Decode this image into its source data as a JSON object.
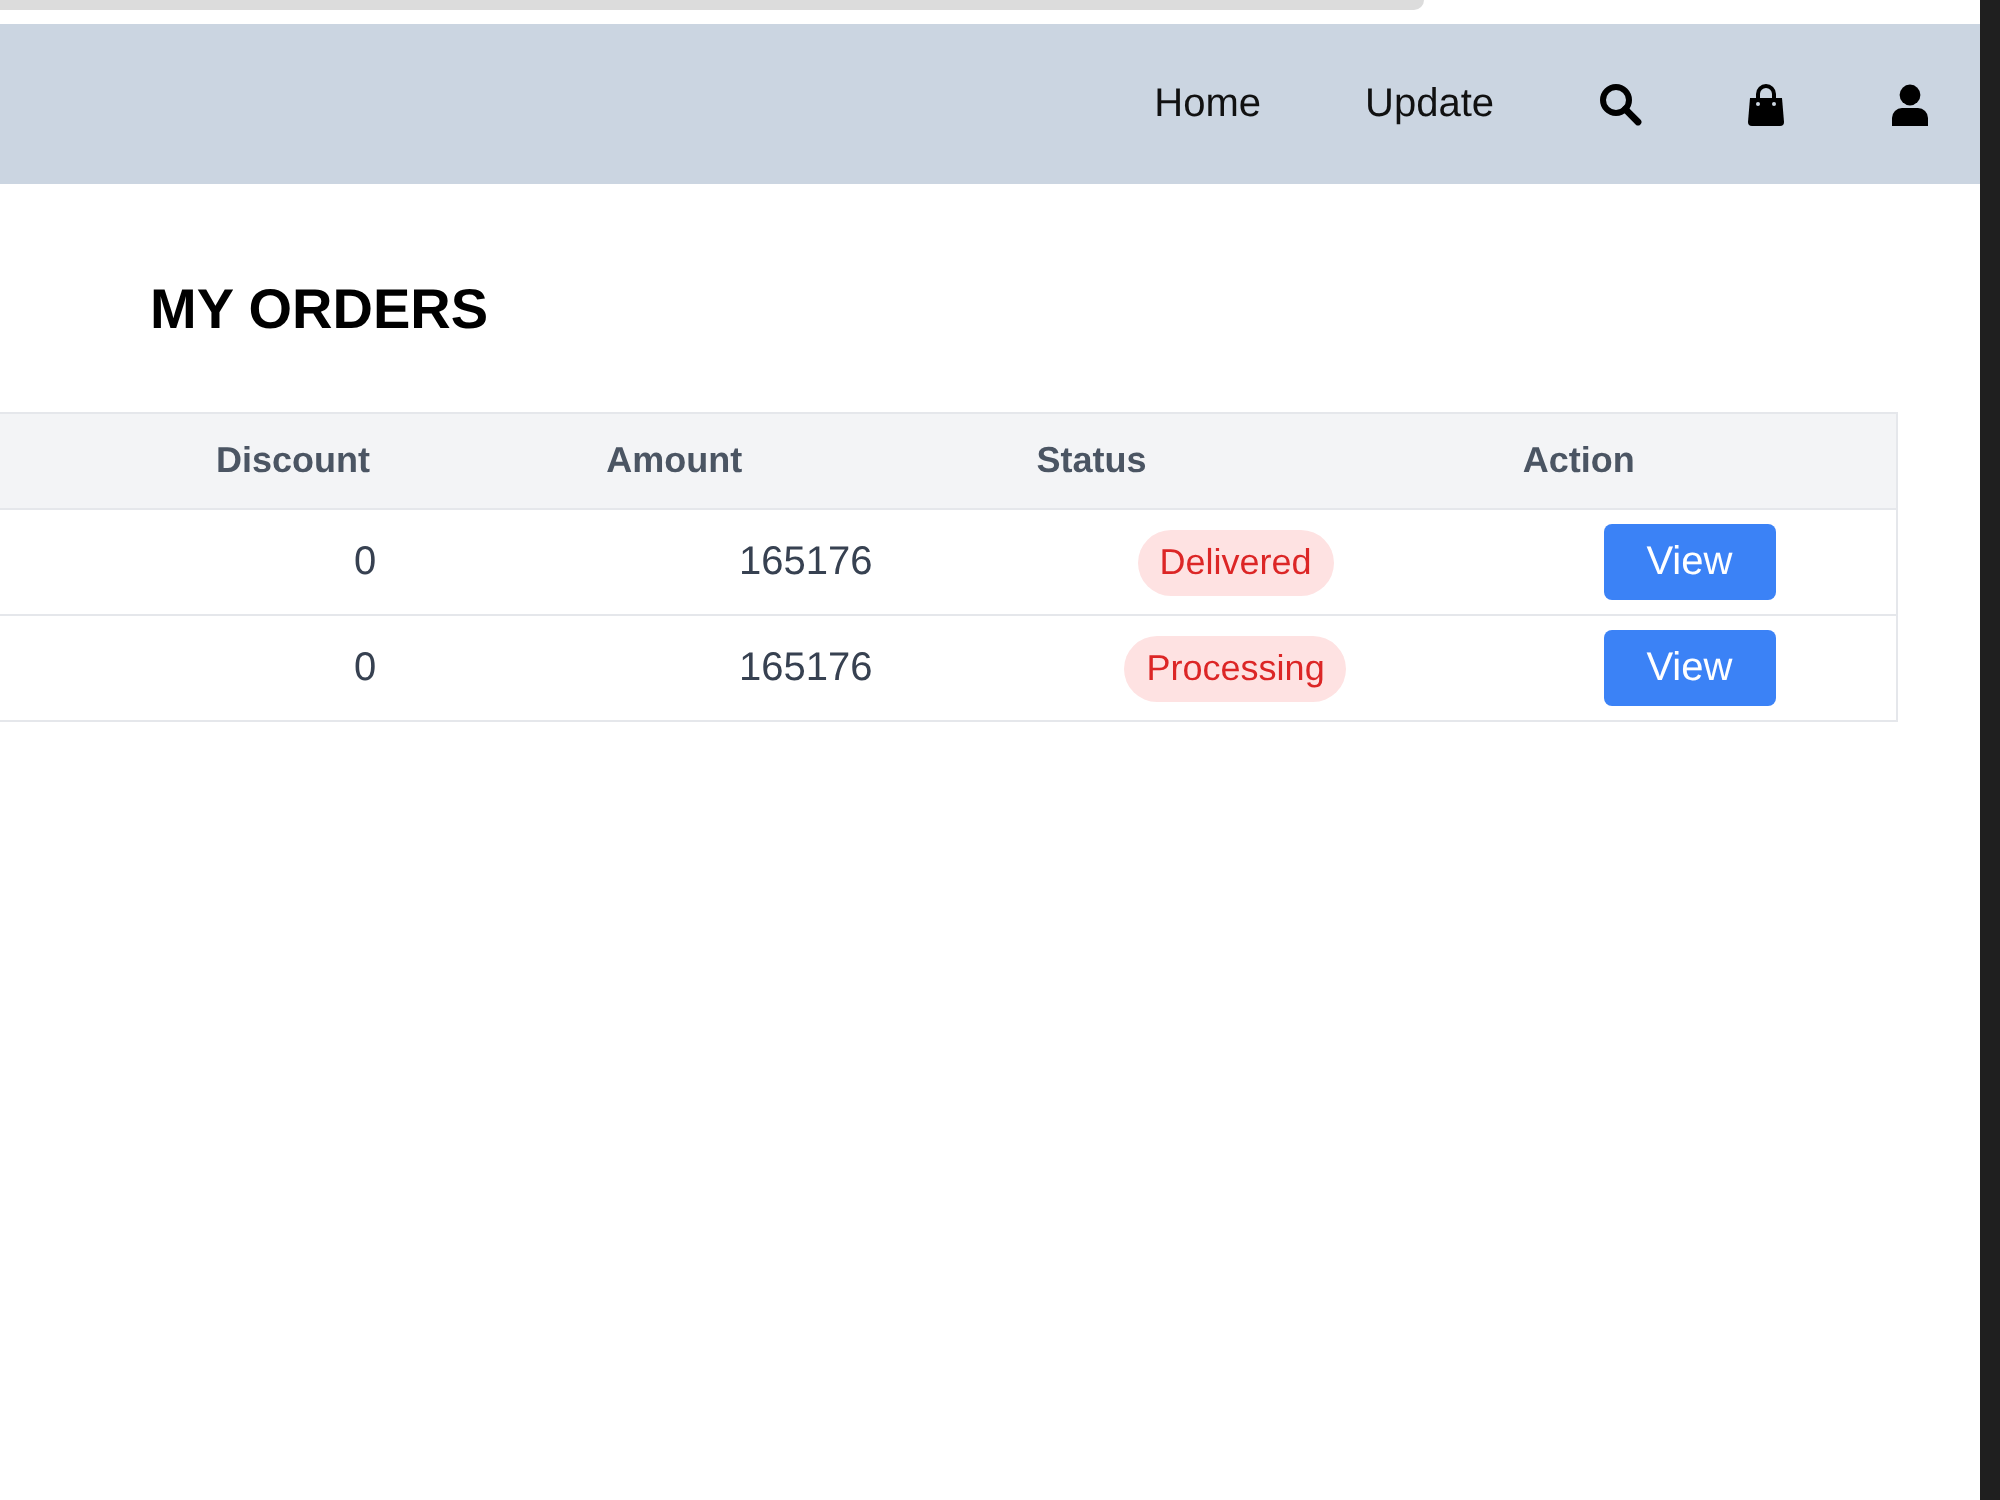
{
  "nav": {
    "links": [
      {
        "label": "Home"
      },
      {
        "label": "Update"
      }
    ]
  },
  "page_title": "MY ORDERS",
  "table": {
    "columns": [
      "Discount",
      "Amount",
      "Status",
      "Action"
    ],
    "rows": [
      {
        "discount": "0",
        "amount": "165176",
        "status": "Delivered",
        "action": "View"
      },
      {
        "discount": "0",
        "amount": "165176",
        "status": "Processing",
        "action": "View"
      }
    ]
  }
}
